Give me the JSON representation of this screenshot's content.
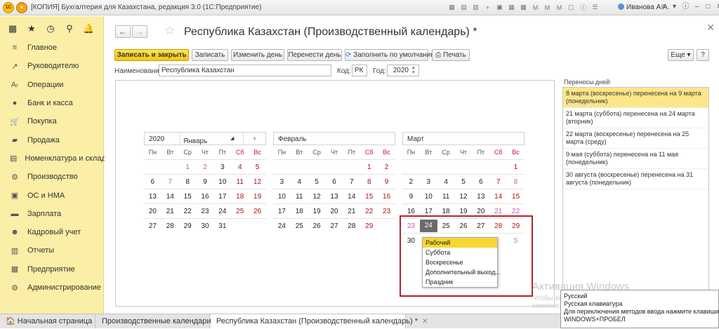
{
  "titlebar": {
    "title": "[КОПИЯ] Бухгалтерия для Казахстана, редакция 3.0 (1С:Предприятие)",
    "user": "Иванова А.А.",
    "logo": "1С"
  },
  "sidebar": {
    "items": [
      {
        "label": "Главное",
        "icon": "≡"
      },
      {
        "label": "Руководителю",
        "icon": "↗"
      },
      {
        "label": "Операции",
        "icon": "Aₜ"
      },
      {
        "label": "Банк и касса",
        "icon": "●"
      },
      {
        "label": "Покупка",
        "icon": "🛒"
      },
      {
        "label": "Продажа",
        "icon": "▰"
      },
      {
        "label": "Номенклатура и склад",
        "icon": "▤"
      },
      {
        "label": "Производство",
        "icon": "⚙"
      },
      {
        "label": "ОС и НМА",
        "icon": "▣"
      },
      {
        "label": "Зарплата",
        "icon": "▬"
      },
      {
        "label": "Кадровый учет",
        "icon": "☻"
      },
      {
        "label": "Отчеты",
        "icon": "▥"
      },
      {
        "label": "Предприятие",
        "icon": "▦"
      },
      {
        "label": "Администрирование",
        "icon": "⚙"
      }
    ]
  },
  "document": {
    "title": "Республика Казахстан (Производственный календарь) *"
  },
  "toolbar": {
    "save_close": "Записать и закрыть",
    "save": "Записать",
    "change_day": "Изменить день",
    "move_day": "Перенести день",
    "fill_default": "Заполнить по умолчанию",
    "print": "Печать",
    "more": "Еще",
    "help": "?"
  },
  "form": {
    "name_label": "Наименование:",
    "name_value": "Республика Казахстан",
    "code_label": "Код:",
    "code_value": "РК",
    "year_label": "Год:",
    "year_value": "2020"
  },
  "calendar": {
    "year": "2020",
    "weekdays": [
      "Пн",
      "Вт",
      "Ср",
      "Чт",
      "Пт",
      "Сб",
      "Вс"
    ],
    "months": [
      {
        "name": "Январь",
        "weeks": [
          [
            "",
            "",
            "1",
            "2",
            "3",
            "4",
            "5"
          ],
          [
            "6",
            "7",
            "8",
            "9",
            "10",
            "11",
            "12"
          ],
          [
            "13",
            "14",
            "15",
            "16",
            "17",
            "18",
            "19"
          ],
          [
            "20",
            "21",
            "22",
            "23",
            "24",
            "25",
            "26"
          ],
          [
            "27",
            "28",
            "29",
            "30",
            "31",
            "",
            ""
          ]
        ]
      },
      {
        "name": "Февраль",
        "weeks": [
          [
            "",
            "",
            "",
            "",
            "",
            "1",
            "2"
          ],
          [
            "3",
            "4",
            "5",
            "6",
            "7",
            "8",
            "9"
          ],
          [
            "10",
            "11",
            "12",
            "13",
            "14",
            "15",
            "16"
          ],
          [
            "17",
            "18",
            "19",
            "20",
            "21",
            "22",
            "23"
          ],
          [
            "24",
            "25",
            "26",
            "27",
            "28",
            "29",
            ""
          ]
        ]
      },
      {
        "name": "Март",
        "weeks": [
          [
            "",
            "",
            "",
            "",
            "",
            "",
            "1"
          ],
          [
            "2",
            "3",
            "4",
            "5",
            "6",
            "7",
            "8"
          ],
          [
            "9",
            "10",
            "11",
            "12",
            "13",
            "14",
            "15"
          ],
          [
            "16",
            "17",
            "18",
            "19",
            "20",
            "21",
            "22"
          ],
          [
            "23",
            "24",
            "25",
            "26",
            "27",
            "28",
            "29"
          ],
          [
            "30",
            "",
            "",
            "",
            "",
            "",
            "5"
          ]
        ]
      }
    ]
  },
  "daytype_menu": {
    "items": [
      "Рабочий",
      "Суббота",
      "Воскресенье",
      "Дополнительный выход...",
      "Праздник"
    ],
    "selected": "Рабочий"
  },
  "transfers": {
    "label": "Переносы дней:",
    "items": [
      "8 марта (воскресенье) перенесена на 9 марта (понедельник)",
      "21 марта (суббота) перенесена на 24 марта (вторник)",
      "22 марта (воскресенье) перенесена на 25 марта (среду)",
      "9 мая (суббота) перенесена на 11 мая (понедельник)",
      "30 августа (воскресенье) перенесена на 31 августа (понедельник)"
    ]
  },
  "tabs": [
    {
      "label": "Начальная страница"
    },
    {
      "label": "Производственные календари"
    },
    {
      "label": "Республика Казахстан (Производственный календарь) *"
    }
  ],
  "overlay": {
    "activation_title": "Активация Windows",
    "activation_text_1": "Чтобы активировать Windows, перейдите в",
    "activation_text_2": "компонент панели управления \"Система\".",
    "lang_1": "Русский",
    "lang_2": "Русская клавиатура",
    "lang_3": "Для переключения методов ввода нажмите клавиши",
    "lang_4": "WINDOWS+ПРОБЕЛ"
  }
}
